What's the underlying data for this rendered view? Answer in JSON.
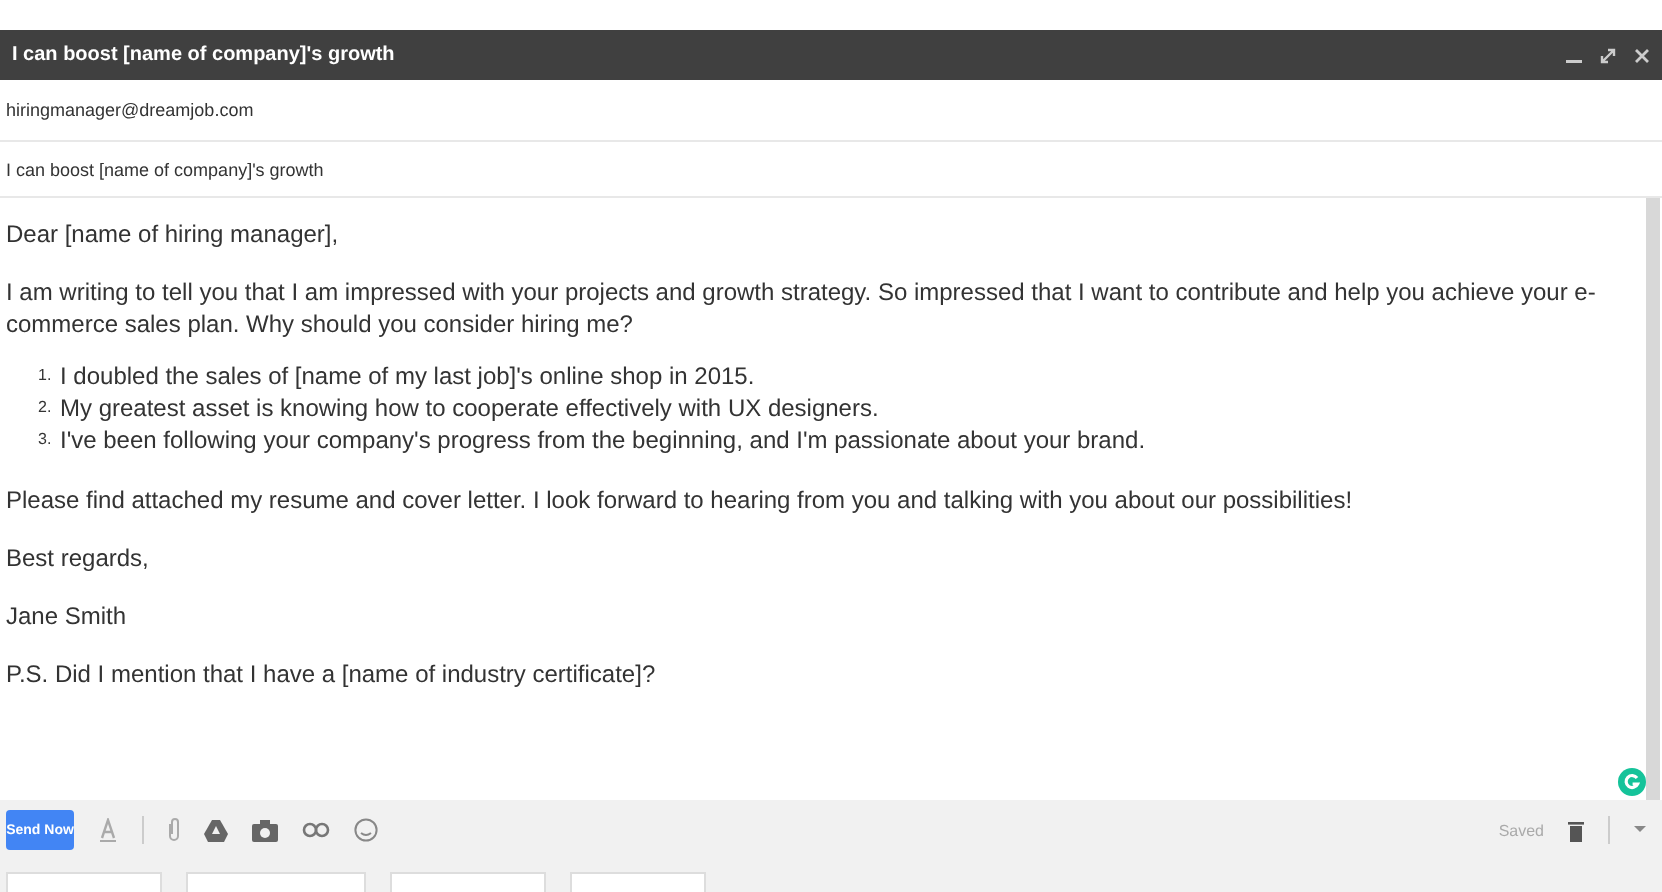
{
  "window": {
    "title": "I can boost [name of company]'s growth"
  },
  "to": "hiringmanager@dreamjob.com",
  "subject": "I can boost [name of company]'s growth",
  "body": {
    "greeting": "Dear [name of hiring manager],",
    "intro": "I am writing to tell you that I am impressed with your projects and growth strategy. So impressed that I want to contribute and help you achieve your e-commerce sales plan. Why should you consider hiring me?",
    "list": [
      {
        "number": "1.",
        "text": "I doubled the sales of [name of my last job]'s online shop in 2015."
      },
      {
        "number": "2.",
        "text": "My greatest asset is knowing how to cooperate effectively with UX designers."
      },
      {
        "number": "3.",
        "text": "I've been following your company's progress from the beginning, and I'm passionate about your brand."
      }
    ],
    "closing": "Please find attached my resume and cover letter. I look forward to hearing from you and talking with you about our possibilities!",
    "signoff": "Best regards,",
    "name": "Jane Smith",
    "ps": "P.S. Did I mention that I have a [name of industry certificate]?"
  },
  "toolbar": {
    "send": "Send Now",
    "status": "Saved"
  }
}
